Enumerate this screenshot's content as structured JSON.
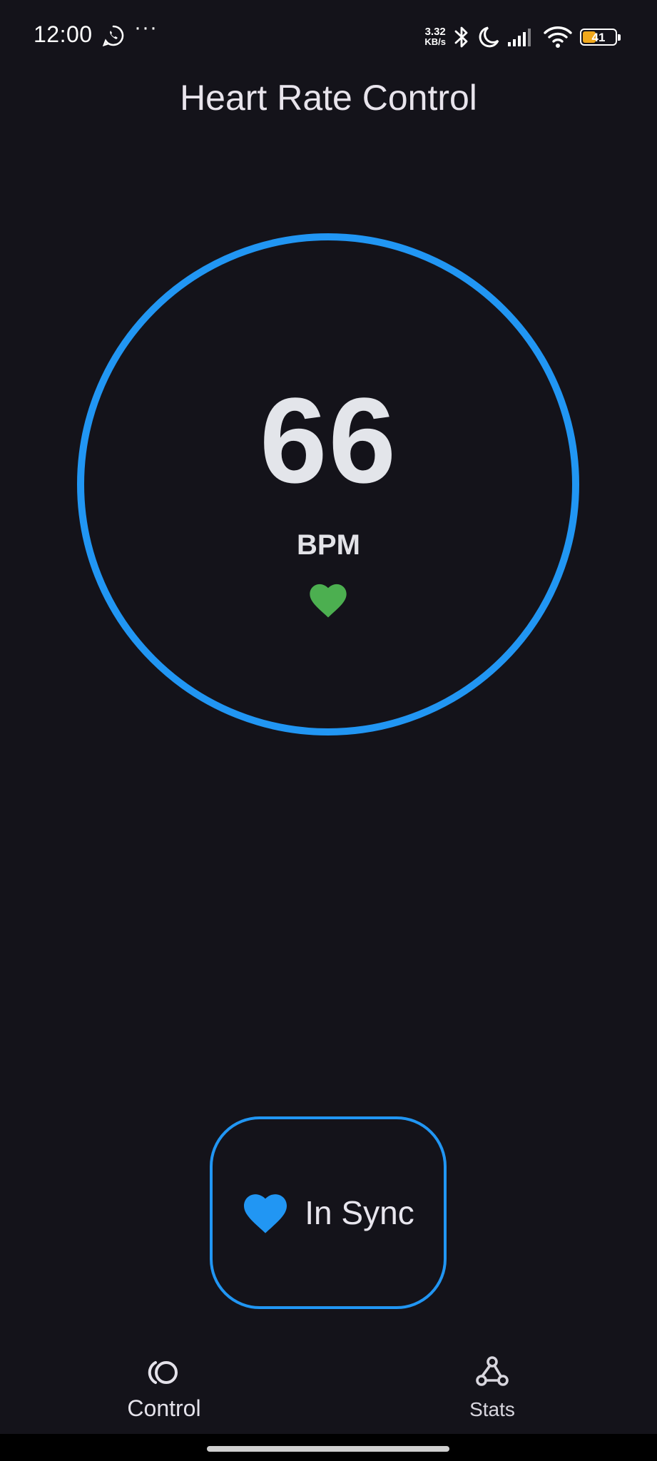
{
  "status_bar": {
    "time": "12:00",
    "more": "···",
    "net_speed_value": "3.32",
    "net_speed_unit": "KB/s",
    "battery_level": "41",
    "icons": [
      "whatsapp-icon",
      "bluetooth-icon",
      "moon-icon",
      "signal-icon",
      "wifi-icon",
      "battery-icon"
    ]
  },
  "header": {
    "title": "Heart Rate Control"
  },
  "gauge": {
    "value": "66",
    "unit": "BPM",
    "ring_color": "#2196f3",
    "heart_color": "#4caf50"
  },
  "sync_button": {
    "label": "In Sync",
    "icon": "heart-icon",
    "accent": "#2196f3"
  },
  "bottom_nav": {
    "items": [
      {
        "label": "Control",
        "icon": "control-icon",
        "selected": true
      },
      {
        "label": "Stats",
        "icon": "webhook-icon",
        "selected": false
      }
    ]
  },
  "colors": {
    "background": "#14131a",
    "accent": "#2196f3"
  }
}
